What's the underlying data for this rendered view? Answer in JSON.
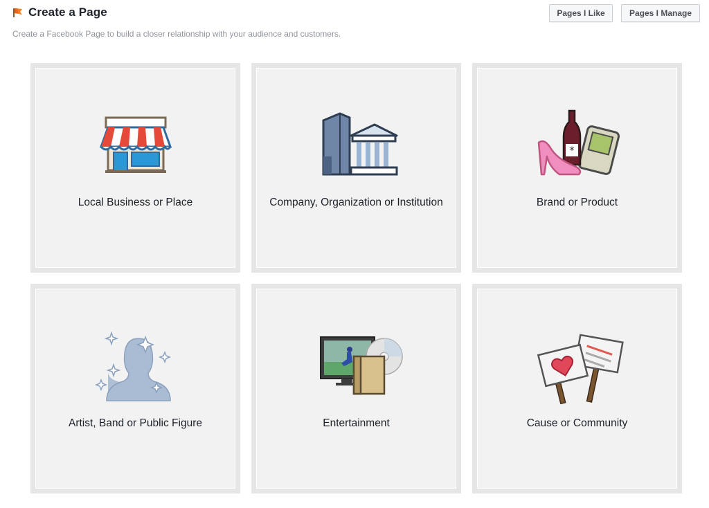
{
  "header": {
    "title": "Create a Page",
    "subtitle": "Create a Facebook Page to build a closer relationship with your audience and customers.",
    "icon": "flag-icon",
    "buttons": {
      "pages_like": "Pages I Like",
      "pages_manage": "Pages I Manage"
    }
  },
  "categories": [
    {
      "label": "Local Business or Place",
      "icon": "storefront-icon"
    },
    {
      "label": "Company, Organization or Institution",
      "icon": "buildings-icon"
    },
    {
      "label": "Brand or Product",
      "icon": "products-icon"
    },
    {
      "label": "Artist, Band or Public Figure",
      "icon": "silhouette-icon"
    },
    {
      "label": "Entertainment",
      "icon": "media-icon"
    },
    {
      "label": "Cause or Community",
      "icon": "signs-icon"
    }
  ],
  "colors": {
    "tile_bg": "#f2f2f2",
    "tile_border": "#e6e6e6",
    "subtitle": "#90949c",
    "accent_orange": "#f5821f"
  }
}
